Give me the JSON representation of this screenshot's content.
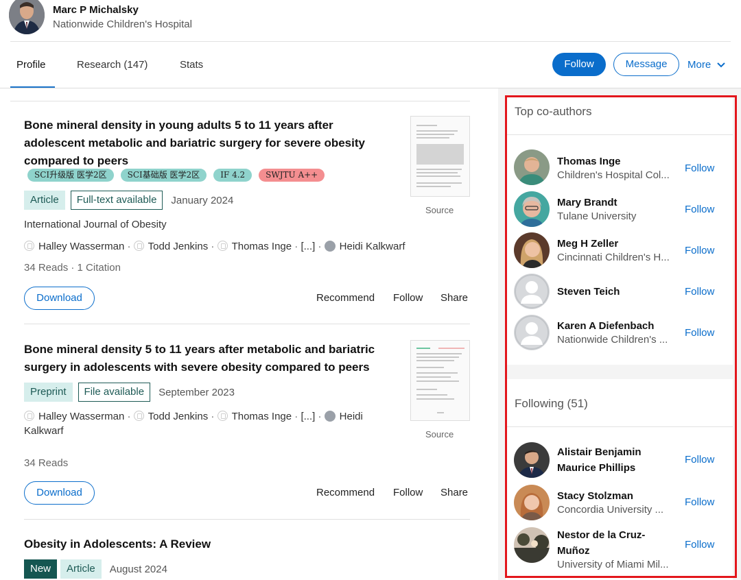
{
  "profile": {
    "name": "Marc P Michalsky",
    "institution": "Nationwide Children's Hospital"
  },
  "tabs": [
    {
      "label": "Profile",
      "active": true
    },
    {
      "label": "Research (147)",
      "active": false
    },
    {
      "label": "Stats",
      "active": false
    }
  ],
  "actions": {
    "follow_label": "Follow",
    "message_label": "Message",
    "more_label": "More"
  },
  "colors": {
    "accent": "#0a6dcb",
    "teal_badge": "#d6eeec",
    "dark_teal": "#155651",
    "highlight_box": "#e3161c"
  },
  "feed": {
    "items": [
      {
        "title": "Bone mineral density in young adults 5 to 11 years after adolescent metabolic and bariatric surgery for severe obesity compared to peers",
        "tags": [
          "SCI升级版 医学2区",
          "SCI基础版 医学2区",
          "IF 4.2",
          "SWJTU A++"
        ],
        "type": "Article",
        "availability": "Full-text available",
        "date": "January 2024",
        "journal": "International Journal of Obesity",
        "authors": [
          "Halley Wasserman",
          "Todd Jenkins",
          "Thomas Inge",
          "[...]",
          "Heidi Kalkwarf"
        ],
        "stats": "34 Reads · 1 Citation",
        "download_label": "Download",
        "recommend_label": "Recommend",
        "follow_label": "Follow",
        "share_label": "Share",
        "source_label": "Source"
      },
      {
        "title": "Bone mineral density 5 to 11 years after metabolic and bariatric surgery in adolescents with severe obesity compared to peers",
        "type": "Preprint",
        "availability": "File available",
        "date": "September 2023",
        "authors": [
          "Halley Wasserman",
          "Todd Jenkins",
          "Thomas Inge",
          "[...]",
          "Heidi Kalkwarf"
        ],
        "stats": "34 Reads",
        "download_label": "Download",
        "recommend_label": "Recommend",
        "follow_label": "Follow",
        "share_label": "Share",
        "source_label": "Source"
      },
      {
        "title": "Obesity in Adolescents: A Review",
        "new_label": "New",
        "type": "Article",
        "date": "August 2024"
      }
    ]
  },
  "sidebar": {
    "coauthors_heading": "Top co-authors",
    "coauthors": [
      {
        "name": "Thomas Inge",
        "affiliation": "Children's Hospital Col...",
        "follow": "Follow"
      },
      {
        "name": "Mary Brandt",
        "affiliation": "Tulane University",
        "follow": "Follow"
      },
      {
        "name": "Meg H Zeller",
        "affiliation": "Cincinnati Children's H...",
        "follow": "Follow"
      },
      {
        "name": "Steven Teich",
        "affiliation": "",
        "follow": "Follow"
      },
      {
        "name": "Karen A Diefenbach",
        "affiliation": "Nationwide Children's ...",
        "follow": "Follow"
      }
    ],
    "following_heading": "Following (51)",
    "following": [
      {
        "name": "Alistair Benjamin Maurice Phillips",
        "affiliation": "",
        "follow": "Follow"
      },
      {
        "name": "Stacy Stolzman",
        "affiliation": "Concordia University ...",
        "follow": "Follow"
      },
      {
        "name": "Nestor de la Cruz-Muñoz",
        "affiliation": "University of Miami Mil...",
        "follow": "Follow"
      }
    ]
  }
}
